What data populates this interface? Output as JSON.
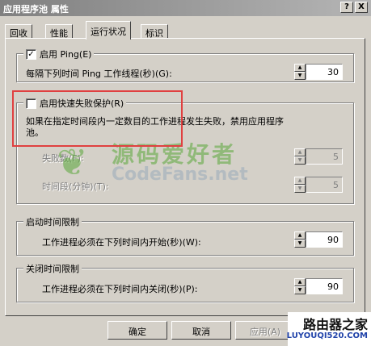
{
  "window": {
    "title": "应用程序池 属性",
    "help_button": "?",
    "close_button": "X"
  },
  "tabs": [
    {
      "label": "回收",
      "active": false
    },
    {
      "label": "性能",
      "active": false
    },
    {
      "label": "运行状况",
      "active": true
    },
    {
      "label": "标识",
      "active": false
    }
  ],
  "ping_group": {
    "checkbox_label": "启用 Ping(E)",
    "checked": true,
    "interval_label": "每隔下列时间 Ping 工作线程(秒)(G):",
    "interval_value": "30"
  },
  "rapid_fail_group": {
    "checkbox_label": "启用快速失败保护(R)",
    "checked": false,
    "description_line1": "如果在指定时间段内一定数目的工作进程发生失败，禁用应用程序",
    "description_line2": "池。",
    "failures_label": "失败数(F):",
    "failures_value": "5",
    "timespan_label": "时间段(分钟)(T):",
    "timespan_value": "5"
  },
  "startup_group": {
    "title": "启动时间限制",
    "label": "工作进程必须在下列时间内开始(秒)(W):",
    "value": "90"
  },
  "shutdown_group": {
    "title": "关闭时间限制",
    "label": "工作进程必须在下列时间内关闭(秒)(P):",
    "value": "90"
  },
  "buttons": {
    "ok": "确定",
    "cancel": "取消",
    "apply": "应用(A)"
  },
  "watermark": {
    "cn": "源码爱好者",
    "en": "CodeFans.net",
    "corner_cn": "路由器之家",
    "corner_en": "LUYOUQI520.COM"
  },
  "colors": {
    "dialog_bg": "#d4d0c8",
    "highlight_box": "#e04040"
  }
}
